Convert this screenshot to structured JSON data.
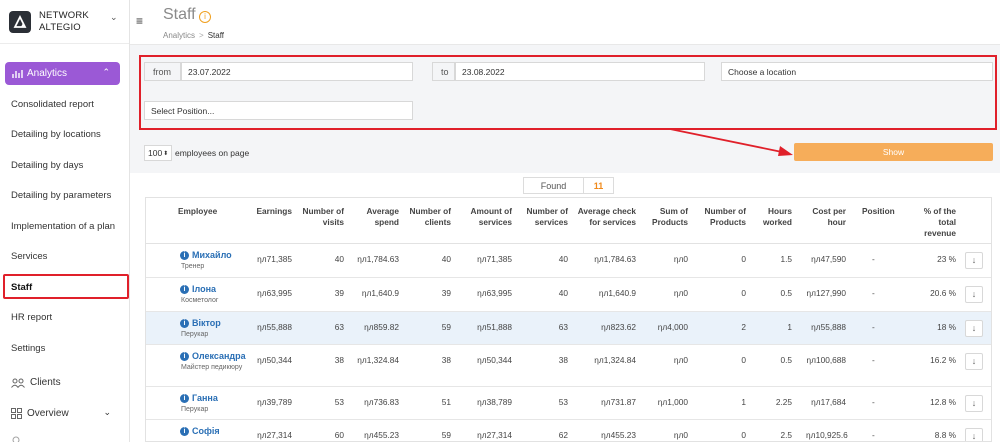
{
  "brand": {
    "line1": "NETWORK",
    "line2": "ALTEGIO"
  },
  "sidebar": {
    "analytics_label": "Analytics",
    "items": [
      "Consolidated report",
      "Detailing by locations",
      "Detailing by days",
      "Detailing by parameters",
      "Implementation of a plan",
      "Services",
      "Staff",
      "HR report",
      "Settings"
    ],
    "clients_label": "Clients",
    "overview_label": "Overview"
  },
  "header": {
    "title": "Staff",
    "breadcrumb_root": "Analytics",
    "breadcrumb_current": "Staff"
  },
  "filters": {
    "from_label": "from",
    "from_value": "23.07.2022",
    "to_label": "to",
    "to_value": "23.08.2022",
    "location_placeholder": "Choose a location",
    "position_placeholder": "Select Position...",
    "per_page_value": "100",
    "per_page_label": "employees on page",
    "show_label": "Show"
  },
  "found": {
    "label": "Found",
    "count": "11"
  },
  "table": {
    "headers": [
      "Employee",
      "Earnings",
      "Number of visits",
      "Average spend",
      "Number of clients",
      "Amount of services",
      "Number of services",
      "Average check for services",
      "Sum of Products",
      "Number of Products",
      "Hours worked",
      "Cost per hour",
      "Position",
      "% of the total revenue"
    ],
    "rows": [
      {
        "name": "Михайло",
        "position": "Тренер",
        "earnings": "ηл71,385",
        "visits": "40",
        "avg_spend": "ηл1,784.63",
        "clients": "40",
        "amount_services": "ηл71,385",
        "num_services": "40",
        "avg_check": "ηл1,784.63",
        "sum_products": "ηл0",
        "num_products": "0",
        "hours": "1.5",
        "cost_hour": "ηл47,590",
        "pos": "-",
        "pct": "23 %"
      },
      {
        "name": "Ілона",
        "position": "Косметолог",
        "earnings": "ηл63,995",
        "visits": "39",
        "avg_spend": "ηл1,640.9",
        "clients": "39",
        "amount_services": "ηл63,995",
        "num_services": "40",
        "avg_check": "ηл1,640.9",
        "sum_products": "ηл0",
        "num_products": "0",
        "hours": "0.5",
        "cost_hour": "ηл127,990",
        "pos": "-",
        "pct": "20.6 %"
      },
      {
        "name": "Віктор",
        "position": "Перукар",
        "earnings": "ηл55,888",
        "visits": "63",
        "avg_spend": "ηл859.82",
        "clients": "59",
        "amount_services": "ηл51,888",
        "num_services": "63",
        "avg_check": "ηл823.62",
        "sum_products": "ηл4,000",
        "num_products": "2",
        "hours": "1",
        "cost_hour": "ηл55,888",
        "pos": "-",
        "pct": "18 %"
      },
      {
        "name": "Олександра",
        "position": "Майстер педикюру",
        "earnings": "ηл50,344",
        "visits": "38",
        "avg_spend": "ηл1,324.84",
        "clients": "38",
        "amount_services": "ηл50,344",
        "num_services": "38",
        "avg_check": "ηл1,324.84",
        "sum_products": "ηл0",
        "num_products": "0",
        "hours": "0.5",
        "cost_hour": "ηл100,688",
        "pos": "-",
        "pct": "16.2 %"
      },
      {
        "name": "Ганна",
        "position": "Перукар",
        "earnings": "ηл39,789",
        "visits": "53",
        "avg_spend": "ηл736.83",
        "clients": "51",
        "amount_services": "ηл38,789",
        "num_services": "53",
        "avg_check": "ηл731.87",
        "sum_products": "ηл1,000",
        "num_products": "1",
        "hours": "2.25",
        "cost_hour": "ηл17,684",
        "pos": "-",
        "pct": "12.8 %"
      },
      {
        "name": "Софія",
        "position": "",
        "earnings": "ηл27,314",
        "visits": "60",
        "avg_spend": "ηл455.23",
        "clients": "59",
        "amount_services": "ηл27,314",
        "num_services": "62",
        "avg_check": "ηл455.23",
        "sum_products": "ηл0",
        "num_products": "0",
        "hours": "2.5",
        "cost_hour": "ηл10,925.6",
        "pos": "-",
        "pct": "8.8 %"
      }
    ]
  }
}
